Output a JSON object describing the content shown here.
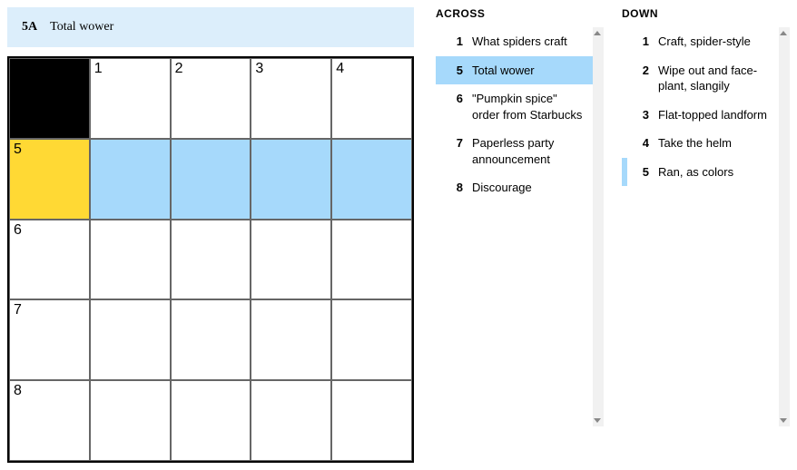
{
  "current_clue": {
    "label": "5A",
    "text": "Total wower"
  },
  "grid": {
    "size": 5,
    "cells": [
      {
        "r": 0,
        "c": 0,
        "block": true
      },
      {
        "r": 0,
        "c": 1,
        "num": "1"
      },
      {
        "r": 0,
        "c": 2,
        "num": "2"
      },
      {
        "r": 0,
        "c": 3,
        "num": "3"
      },
      {
        "r": 0,
        "c": 4,
        "num": "4"
      },
      {
        "r": 1,
        "c": 0,
        "num": "5",
        "state": "active"
      },
      {
        "r": 1,
        "c": 1,
        "state": "hl"
      },
      {
        "r": 1,
        "c": 2,
        "state": "hl"
      },
      {
        "r": 1,
        "c": 3,
        "state": "hl"
      },
      {
        "r": 1,
        "c": 4,
        "state": "hl"
      },
      {
        "r": 2,
        "c": 0,
        "num": "6"
      },
      {
        "r": 2,
        "c": 1
      },
      {
        "r": 2,
        "c": 2
      },
      {
        "r": 2,
        "c": 3
      },
      {
        "r": 2,
        "c": 4
      },
      {
        "r": 3,
        "c": 0,
        "num": "7"
      },
      {
        "r": 3,
        "c": 1
      },
      {
        "r": 3,
        "c": 2
      },
      {
        "r": 3,
        "c": 3
      },
      {
        "r": 3,
        "c": 4
      },
      {
        "r": 4,
        "c": 0,
        "num": "8"
      },
      {
        "r": 4,
        "c": 1
      },
      {
        "r": 4,
        "c": 2
      },
      {
        "r": 4,
        "c": 3
      },
      {
        "r": 4,
        "c": 4
      }
    ]
  },
  "headings": {
    "across": "ACROSS",
    "down": "DOWN"
  },
  "across": [
    {
      "num": "1",
      "text": "What spiders craft"
    },
    {
      "num": "5",
      "text": "Total wower",
      "selected": true
    },
    {
      "num": "6",
      "text": "\"Pumpkin spice\" order from Starbucks"
    },
    {
      "num": "7",
      "text": "Paperless party announcement"
    },
    {
      "num": "8",
      "text": "Discourage"
    }
  ],
  "down": [
    {
      "num": "1",
      "text": "Craft, spider-style"
    },
    {
      "num": "2",
      "text": "Wipe out and face-plant, slangily"
    },
    {
      "num": "3",
      "text": "Flat-topped landform"
    },
    {
      "num": "4",
      "text": "Take the helm"
    },
    {
      "num": "5",
      "text": "Ran, as colors",
      "related": true
    }
  ]
}
